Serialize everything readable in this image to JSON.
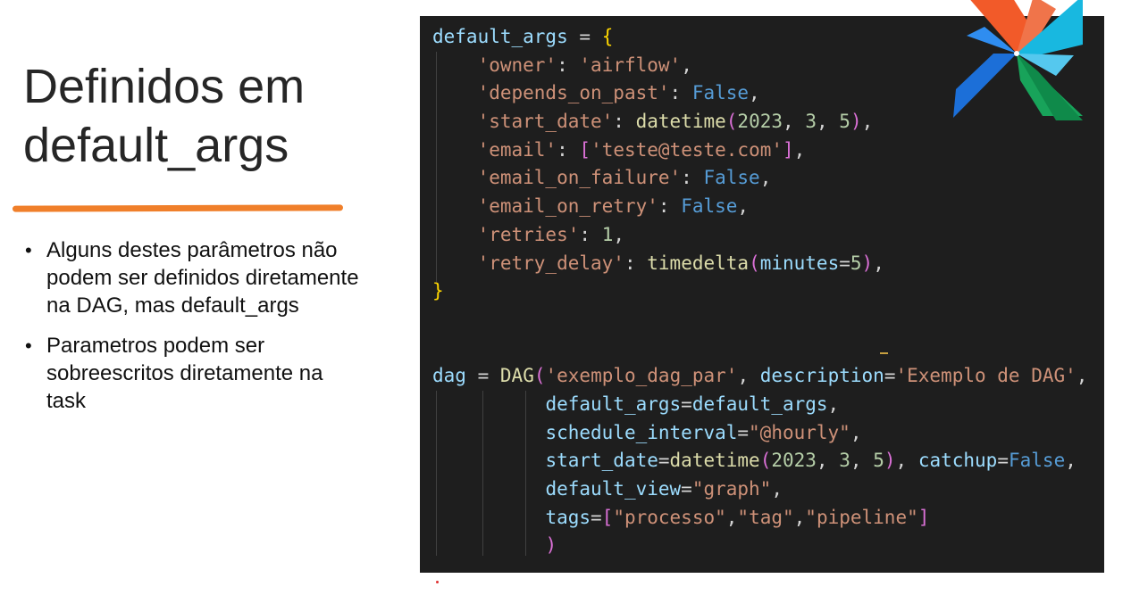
{
  "slide": {
    "title": "Definidos em\ndefault_args",
    "bullets": [
      "Alguns destes parâmetros não podem ser definidos diretamente na DAG, mas default_args",
      "Parametros podem ser sobreescritos diretamente na task"
    ]
  },
  "code": {
    "lines": [
      "default_args = {",
      "    'owner': 'airflow',",
      "    'depends_on_past': False,",
      "    'start_date': datetime(2023, 3, 5),",
      "    'email': ['teste@teste.com'],",
      "    'email_on_failure': False,",
      "    'email_on_retry': False,",
      "    'retries': 1,",
      "    'retry_delay': timedelta(minutes=5),",
      "}",
      "",
      "",
      "dag = DAG('exemplo_dag_par', description='Exemplo de DAG',",
      "          default_args=default_args,",
      "          schedule_interval=\"@hourly\",",
      "          start_date=datetime(2023, 3, 5), catchup=False,",
      "          default_view=\"graph\",",
      "          tags=[\"processo\",\"tag\",\"pipeline\"]",
      "          )"
    ]
  },
  "colors": {
    "accent_underline": "#f07f2a",
    "code_background": "#1e1e1e"
  },
  "icons": {
    "logo": "airflow-pinwheel-logo"
  }
}
